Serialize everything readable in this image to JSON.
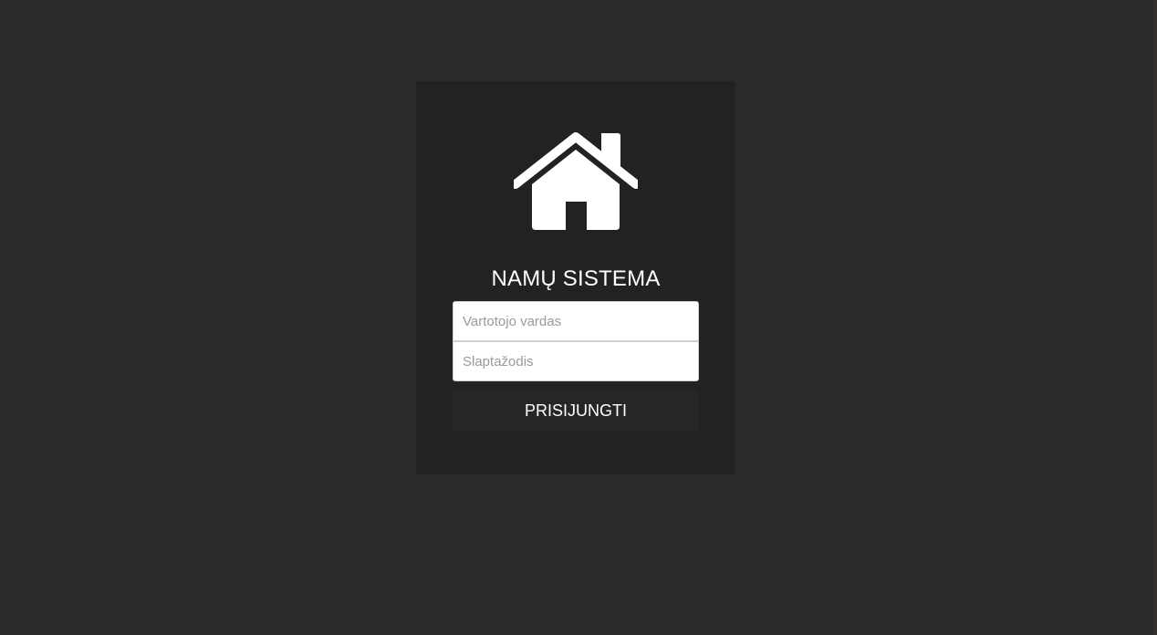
{
  "login": {
    "logo_icon": "house-icon",
    "title": "NAMŲ SISTEMA",
    "username_placeholder": "Vartotojo vardas",
    "password_placeholder": "Slaptažodis",
    "submit_label": "PRISIJUNGTI"
  },
  "colors": {
    "page_background": "#2a2a2a",
    "card_background": "#222222",
    "button_background": "#262626",
    "text": "#ffffff"
  }
}
